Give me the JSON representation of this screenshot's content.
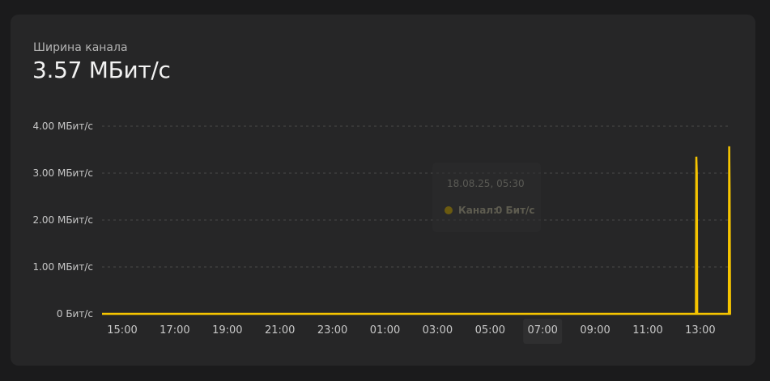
{
  "card": {
    "label": "Ширина канала",
    "value": "3.57 МБит/с"
  },
  "colors": {
    "series": "#f5c400",
    "grid": "#4a4a4a",
    "background": "#262627"
  },
  "tooltip": {
    "time": "18.08.25, 05:30",
    "series_label": "Канал:",
    "series_value": "0 Бит/с"
  },
  "chart_data": {
    "type": "line",
    "title": "",
    "xlabel": "",
    "ylabel": "",
    "ylim": [
      0,
      4
    ],
    "y_unit": "МБит/с",
    "y_ticks": [
      {
        "value": 0,
        "label": "0 Бит/с"
      },
      {
        "value": 1,
        "label": "1.00 МБит/с"
      },
      {
        "value": 2,
        "label": "2.00 МБит/с"
      },
      {
        "value": 3,
        "label": "3.00 МБит/с"
      },
      {
        "value": 4,
        "label": "4.00 МБит/с"
      }
    ],
    "x_ticks": [
      "15:00",
      "17:00",
      "19:00",
      "21:00",
      "23:00",
      "01:00",
      "03:00",
      "05:00",
      "07:00",
      "09:00",
      "11:00",
      "13:00"
    ],
    "highlighted_x_tick": "07:00",
    "grid": true,
    "legend": "none",
    "series": [
      {
        "x": [
          "14:12",
          "12:50",
          "12:51",
          "12:52",
          "12:53",
          "12:55",
          "14:05",
          "14:06",
          "14:07",
          "14:08",
          "14:10"
        ],
        "values": [
          0,
          0,
          3.35,
          3.0,
          0,
          0,
          0,
          3.57,
          2.62,
          0,
          0
        ]
      }
    ]
  }
}
